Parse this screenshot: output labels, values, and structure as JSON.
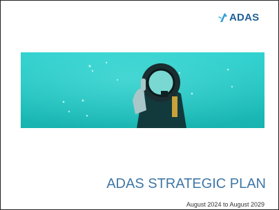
{
  "logo": {
    "icon": "diver-splash-icon",
    "text": "ADAS"
  },
  "hero": {
    "image": "diver-thumbs-up-underwater"
  },
  "document": {
    "title": "ADAS STRATEGIC PLAN",
    "subtitle": "August 2024 to August 2029"
  },
  "colors": {
    "brand_blue": "#1f5f94",
    "title_blue": "#3f77a6",
    "water": "#1fc7c4"
  }
}
